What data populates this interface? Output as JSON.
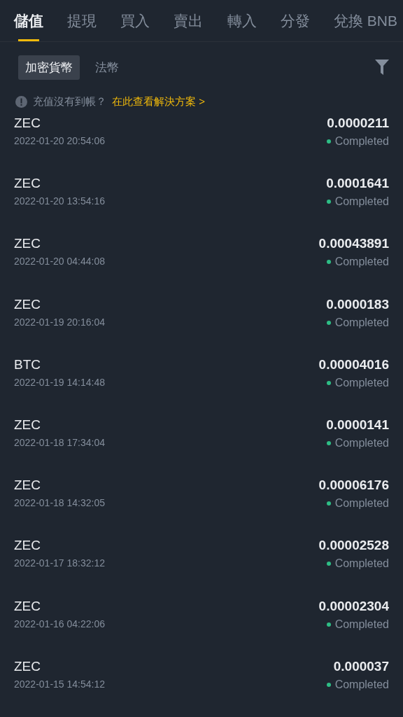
{
  "tabs": [
    {
      "label": "儲值",
      "selected": true
    },
    {
      "label": "提現",
      "selected": false
    },
    {
      "label": "買入",
      "selected": false
    },
    {
      "label": "賣出",
      "selected": false
    },
    {
      "label": "轉入",
      "selected": false
    },
    {
      "label": "分發",
      "selected": false
    },
    {
      "label": "兌換 BNB",
      "selected": false
    }
  ],
  "subtabs": [
    {
      "label": "加密貨幣",
      "selected": true
    },
    {
      "label": "法幣",
      "selected": false
    }
  ],
  "notice": {
    "text": "充值沒有到帳？",
    "link": "在此查看解決方案 >"
  },
  "records": [
    {
      "coin": "ZEC",
      "time": "2022-01-20 20:54:06",
      "amount": "0.0000211",
      "status": "Completed"
    },
    {
      "coin": "ZEC",
      "time": "2022-01-20 13:54:16",
      "amount": "0.0001641",
      "status": "Completed"
    },
    {
      "coin": "ZEC",
      "time": "2022-01-20 04:44:08",
      "amount": "0.00043891",
      "status": "Completed"
    },
    {
      "coin": "ZEC",
      "time": "2022-01-19 20:16:04",
      "amount": "0.0000183",
      "status": "Completed"
    },
    {
      "coin": "BTC",
      "time": "2022-01-19 14:14:48",
      "amount": "0.00004016",
      "status": "Completed"
    },
    {
      "coin": "ZEC",
      "time": "2022-01-18 17:34:04",
      "amount": "0.0000141",
      "status": "Completed"
    },
    {
      "coin": "ZEC",
      "time": "2022-01-18 14:32:05",
      "amount": "0.00006176",
      "status": "Completed"
    },
    {
      "coin": "ZEC",
      "time": "2022-01-17 18:32:12",
      "amount": "0.00002528",
      "status": "Completed"
    },
    {
      "coin": "ZEC",
      "time": "2022-01-16 04:22:06",
      "amount": "0.00002304",
      "status": "Completed"
    },
    {
      "coin": "ZEC",
      "time": "2022-01-15 14:54:12",
      "amount": "0.000037",
      "status": "Completed"
    }
  ]
}
